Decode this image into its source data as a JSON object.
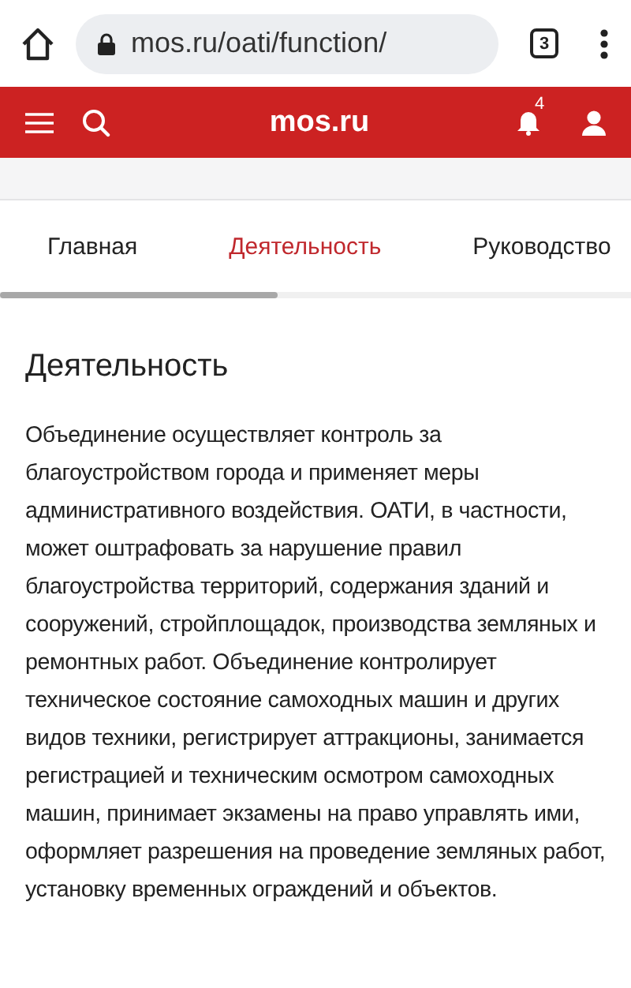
{
  "browser": {
    "url": "mos.ru/oati/function/",
    "tab_count": "3"
  },
  "header": {
    "logo": "mos.ru",
    "notification_count": "4"
  },
  "tabs": [
    {
      "label": "Главная",
      "selected": false
    },
    {
      "label": "Деятельность",
      "selected": true
    },
    {
      "label": "Руководство",
      "selected": false
    }
  ],
  "heading": "Деятельность",
  "paragraph": "Объединение осуществляет контроль за благоустройством города и применяет меры административного воздействия. ОАТИ, в частности, может оштрафовать за нарушение правил благоустройства территорий, содержания зданий и сооружений, стройплощадок, производства земляных и ремонтных работ. Объединение контролирует техническое состояние самоходных машин и других видов техники, регистрирует аттракционы, занимается регистрацией и техническим осмотром самоходных машин, принимает экзамены на право управлять ими, оформляет разрешения на проведение земляных работ, установку временных ограждений и объектов."
}
